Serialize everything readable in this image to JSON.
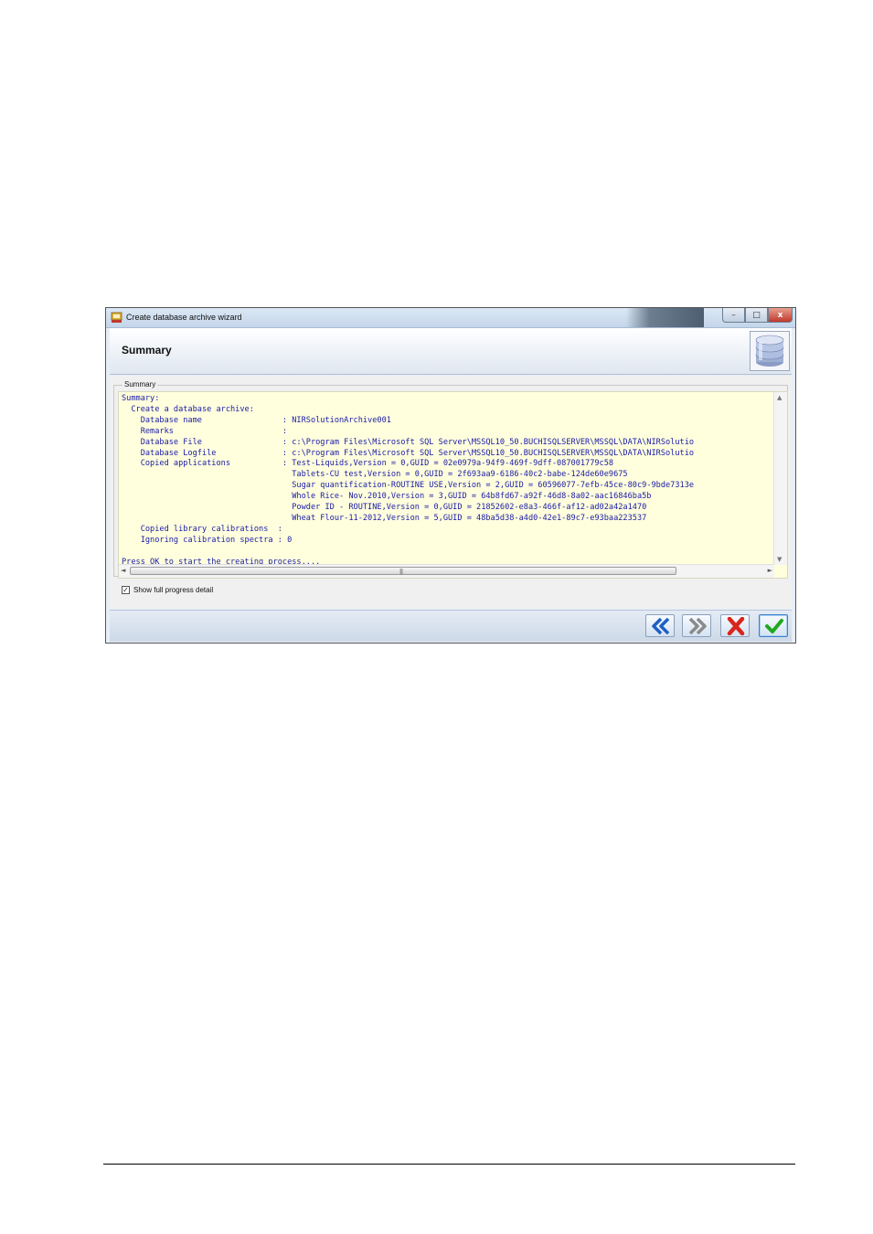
{
  "window": {
    "title": "Create database archive wizard",
    "controls": {
      "minimize": "–",
      "maximize": "□",
      "close": "x"
    }
  },
  "header": {
    "title": "Summary"
  },
  "summary_group": {
    "legend": "Summary",
    "lines": [
      "Summary:",
      "  Create a database archive:",
      "    Database name                 : NIRSolutionArchive001",
      "    Remarks                       :",
      "    Database File                 : c:\\Program Files\\Microsoft SQL Server\\MSSQL10_50.BUCHISQLSERVER\\MSSQL\\DATA\\NIRSolutio",
      "    Database Logfile              : c:\\Program Files\\Microsoft SQL Server\\MSSQL10_50.BUCHISQLSERVER\\MSSQL\\DATA\\NIRSolutio",
      "    Copied applications           : Test-Liquids,Version = 0,GUID = 02e0979a-94f9-469f-9dff-087001779c58",
      "                                    Tablets-CU test,Version = 0,GUID = 2f693aa9-6186-40c2-babe-124de60e9675",
      "                                    Sugar quantification-ROUTINE USE,Version = 2,GUID = 60596077-7efb-45ce-80c9-9bde7313e",
      "                                    Whole Rice- Nov.2010,Version = 3,GUID = 64b8fd67-a92f-46d8-8a02-aac16846ba5b",
      "                                    Powder ID - ROUTINE,Version = 0,GUID = 21852602-e8a3-466f-af12-ad02a42a1470",
      "                                    Wheat Flour-11-2012,Version = 5,GUID = 48ba5d38-a4d0-42e1-89c7-e93baa223537",
      "    Copied library calibrations  :",
      "    Ignoring calibration spectra : 0",
      "",
      "Press OK to start the creating process...."
    ]
  },
  "scroll": {
    "up": "▲",
    "down": "▼",
    "left": "◄",
    "right": "►",
    "grip": "|||"
  },
  "options": {
    "show_full_progress_label": "Show full progress detail",
    "checkmark": "✓"
  },
  "buttons": {
    "back": "Back",
    "next": "Next",
    "cancel": "Cancel",
    "ok": "OK"
  },
  "colors": {
    "text_blue": "#1a1aa8",
    "summary_background": "#ffffdd",
    "ok_green": "#1fa81f",
    "cancel_red": "#d9261c",
    "back_blue": "#1d5fc4"
  }
}
